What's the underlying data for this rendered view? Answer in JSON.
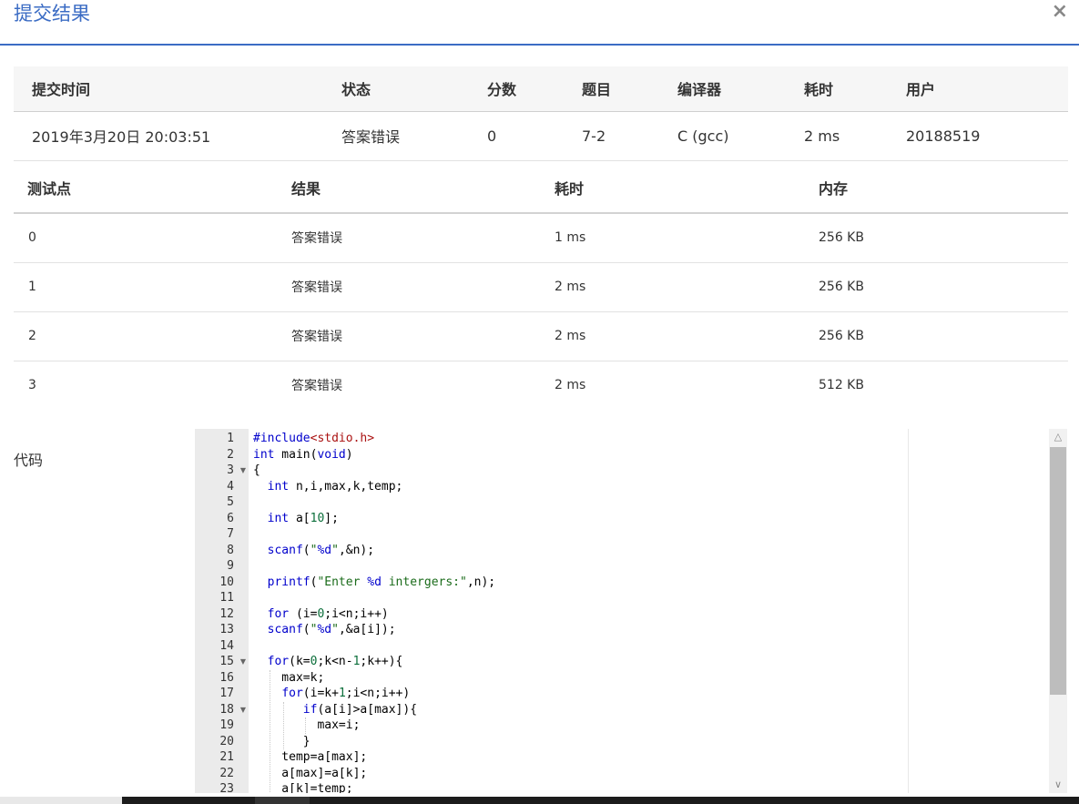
{
  "dialog": {
    "title": "提交结果",
    "close_icon": "×"
  },
  "submission": {
    "headers": [
      "提交时间",
      "状态",
      "分数",
      "题目",
      "编译器",
      "耗时",
      "用户"
    ],
    "time": "2019年3月20日 20:03:51",
    "status": "答案错误",
    "score": "0",
    "problem": "7-2",
    "compiler": "C (gcc)",
    "elapsed": "2 ms",
    "user": "20188519"
  },
  "testcases": {
    "headers": [
      "测试点",
      "结果",
      "耗时",
      "内存"
    ],
    "rows": [
      {
        "id": "0",
        "result": "答案错误",
        "time": "1 ms",
        "memory": "256 KB"
      },
      {
        "id": "1",
        "result": "答案错误",
        "time": "2 ms",
        "memory": "256 KB"
      },
      {
        "id": "2",
        "result": "答案错误",
        "time": "2 ms",
        "memory": "256 KB"
      },
      {
        "id": "3",
        "result": "答案错误",
        "time": "2 ms",
        "memory": "512 KB"
      }
    ]
  },
  "code": {
    "label": "代码",
    "lines": [
      "#include<stdio.h>",
      "int main(void)",
      "{",
      "  int n,i,max,k,temp;",
      "",
      "  int a[10];",
      "",
      "  scanf(\"%d\",&n);",
      "",
      "  printf(\"Enter %d intergers:\",n);",
      "",
      "  for (i=0;i<n;i++)",
      "  scanf(\"%d\",&a[i]);",
      "",
      "  for(k=0;k<n-1;k++){",
      "    max=k;",
      "    for(i=k+1;i<n;i++)",
      "       if(a[i]>a[max]){",
      "         max=i;",
      "       }",
      "    temp=a[max];",
      "    a[max]=a[k];",
      "    a[k]=temp;"
    ],
    "fold_lines": [
      3,
      15,
      18
    ]
  },
  "colors": {
    "accent": "#3b6cc4",
    "status_wrong": "#3d9a3d",
    "link": "#2b5aa6"
  }
}
